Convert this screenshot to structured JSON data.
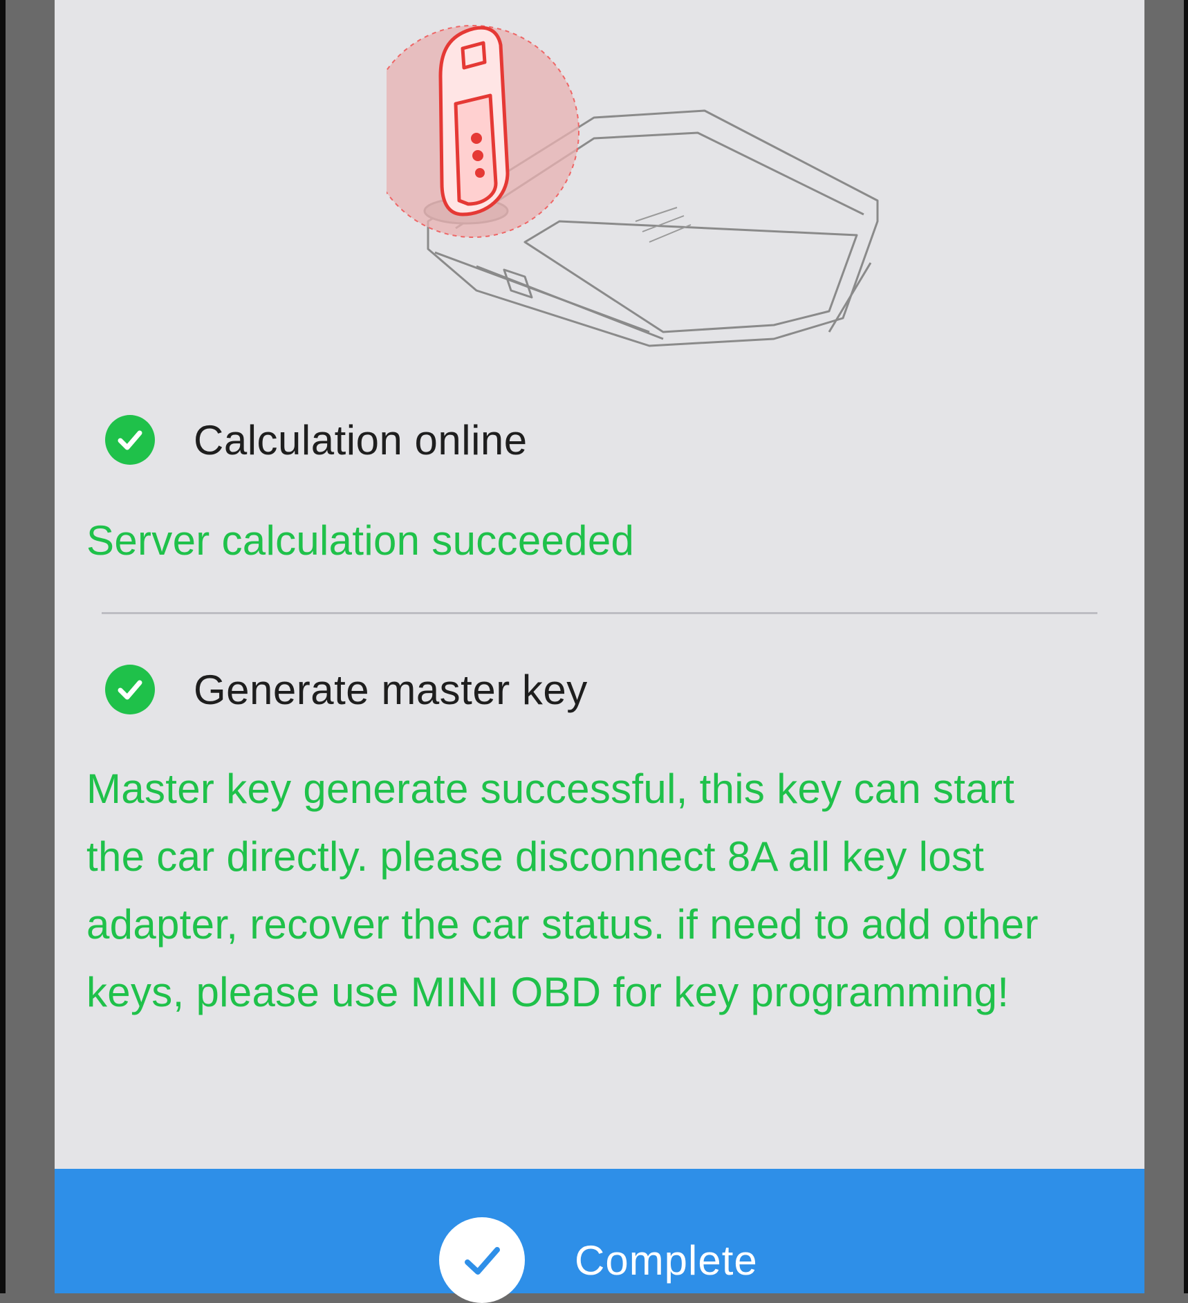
{
  "steps": [
    {
      "title": "Calculation online",
      "icon": "check-circle-icon",
      "status": "success",
      "result": "Server calculation succeeded"
    },
    {
      "title": "Generate master key",
      "icon": "check-circle-icon",
      "status": "success",
      "result": "Master key generate successful, this key can start the car directly. please disconnect 8A all key lost adapter, recover the car status. if need to add other keys, please use MINI OBD for key programming!"
    }
  ],
  "complete_button": {
    "label": "Complete",
    "icon": "checkmark-icon"
  },
  "colors": {
    "success": "#1fc14a",
    "accent": "#2e8fe8",
    "panel_bg": "#e4e4e7",
    "highlight": "#e53935"
  },
  "illustration": {
    "icon": "key-in-programmer-illustration"
  }
}
